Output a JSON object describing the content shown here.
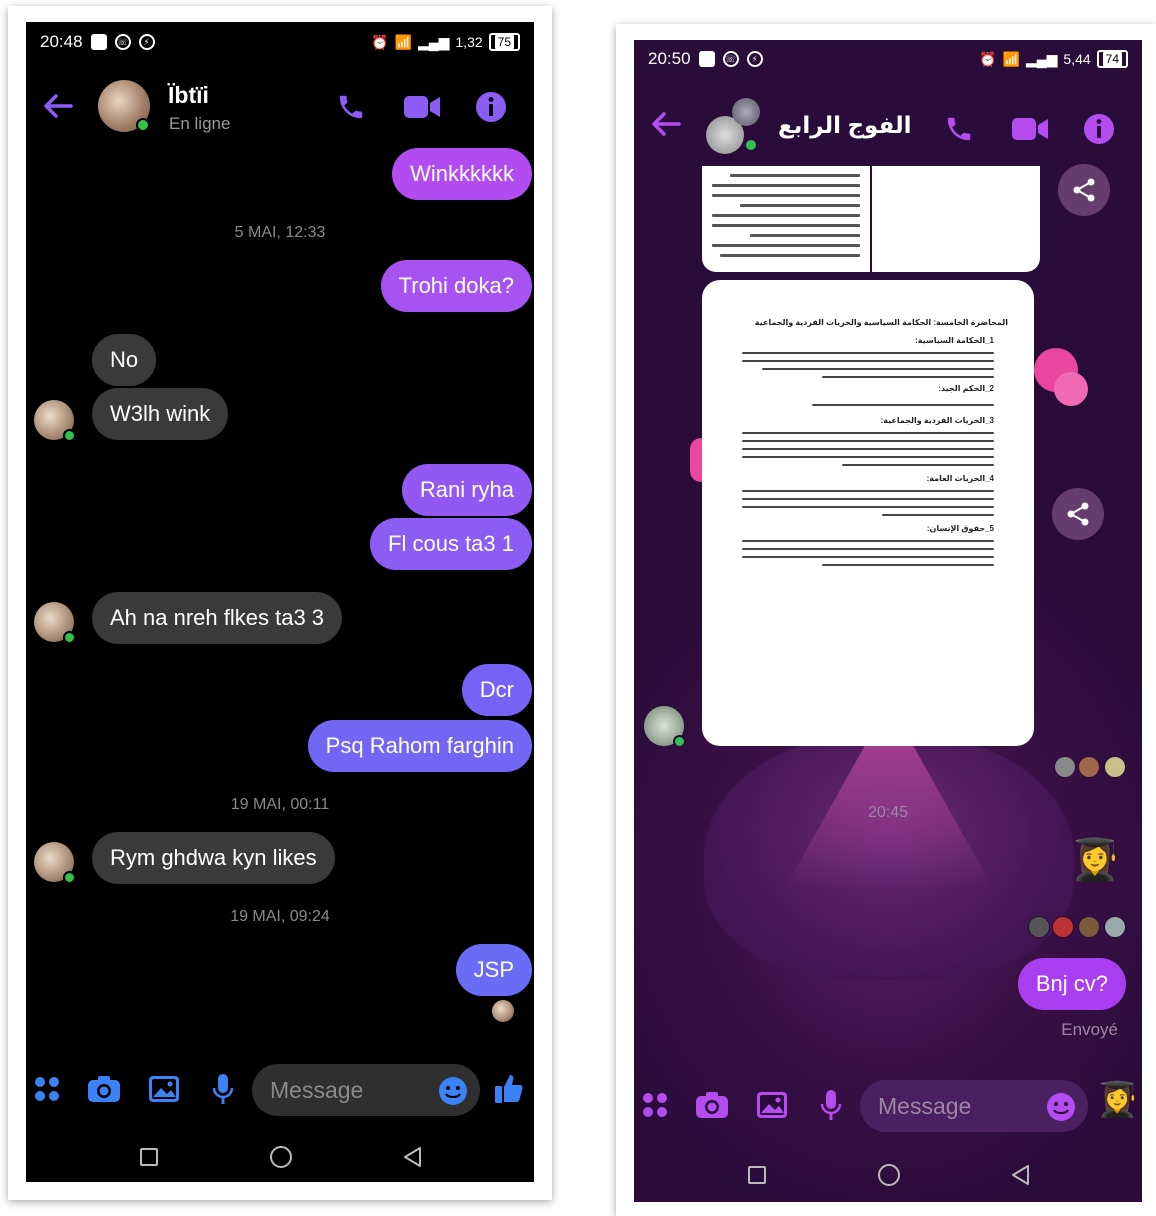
{
  "left": {
    "status": {
      "time": "20:48",
      "net": "1,32",
      "battery": "75"
    },
    "header": {
      "name": "Ïbtïi",
      "status": "En ligne"
    },
    "messages": [
      {
        "text": "Winkkkkkk",
        "dir": "out"
      },
      {
        "ts": "5 MAI, 12:33"
      },
      {
        "text": "Trohi doka?",
        "dir": "out"
      },
      {
        "text": "No",
        "dir": "in"
      },
      {
        "text": "W3lh wink",
        "dir": "in"
      },
      {
        "text": "Rani ryha",
        "dir": "out"
      },
      {
        "text": "Fl cous ta3 1",
        "dir": "out"
      },
      {
        "text": "Ah na nreh flkes ta3 3",
        "dir": "in"
      },
      {
        "text": "Dcr",
        "dir": "out"
      },
      {
        "text": "Psq Rahom farghin",
        "dir": "out"
      },
      {
        "ts": "19 MAI, 00:11"
      },
      {
        "text": "Rym ghdwa kyn likes",
        "dir": "in"
      },
      {
        "ts": "19 MAI, 09:24"
      },
      {
        "text": "JSP",
        "dir": "out"
      }
    ],
    "composer": {
      "placeholder": "Message"
    },
    "colors": {
      "accent": "#8b5cf6",
      "bubble_top": "#b24cf0",
      "bubble_bottom": "#6a6cf6",
      "incoming": "#3a3a3a"
    }
  },
  "right": {
    "status": {
      "time": "20:50",
      "net": "5,44",
      "battery": "74"
    },
    "header": {
      "name": "الفوج الرابع"
    },
    "doc": {
      "title": "المحاضرة الخامسة: الحكامة السياسية والحريات الفردية والجماعية",
      "s1": "1_الحكامة السياسية:",
      "s2": "2_الحكم الجيد:",
      "s3": "3_الحريات الفردية والجماعية:",
      "s4": "4_الحريات العامة:",
      "s5": "5_حقوق الإنسان:"
    },
    "time_marker": "20:45",
    "messages": [
      {
        "text": "Bnj cv?",
        "dir": "out"
      }
    ],
    "sent_label": "Envoyé",
    "composer": {
      "placeholder": "Message"
    },
    "colors": {
      "accent": "#b44cf0",
      "bubble": "#a83ef0"
    }
  }
}
